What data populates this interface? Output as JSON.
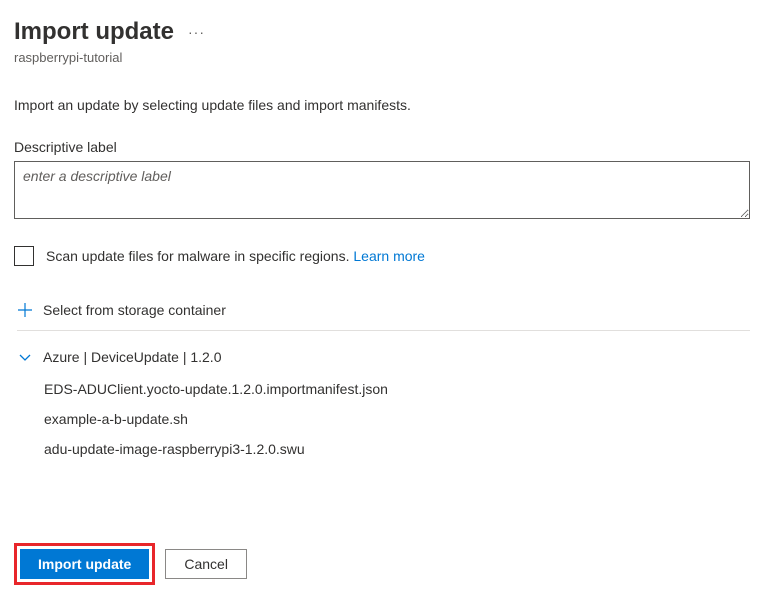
{
  "header": {
    "title": "Import update",
    "subtitle": "raspberrypi-tutorial"
  },
  "description": "Import an update by selecting update files and import manifests.",
  "descriptive_label": {
    "label": "Descriptive label",
    "placeholder": "enter a descriptive label"
  },
  "scan": {
    "label": "Scan update files for malware in specific regions. ",
    "learn_more": "Learn more"
  },
  "storage": {
    "select_label": "Select from storage container"
  },
  "group": {
    "label": "Azure | DeviceUpdate | 1.2.0",
    "files": [
      "EDS-ADUClient.yocto-update.1.2.0.importmanifest.json",
      "example-a-b-update.sh",
      "adu-update-image-raspberrypi3-1.2.0.swu"
    ]
  },
  "footer": {
    "import_label": "Import update",
    "cancel_label": "Cancel"
  }
}
